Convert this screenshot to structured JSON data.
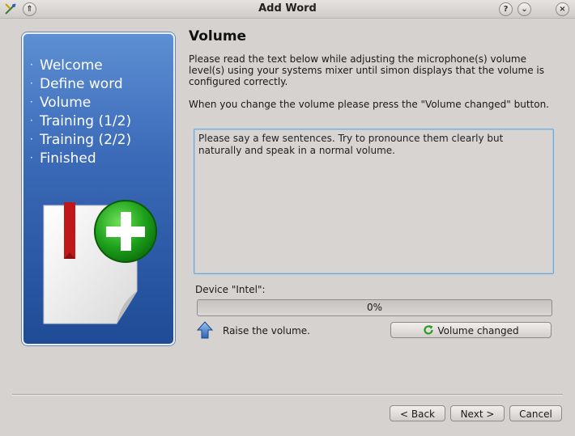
{
  "window": {
    "title": "Add Word",
    "help_label": "?",
    "minimize_label": "⌄",
    "close_label": "×",
    "keep_above_label": "⇑"
  },
  "sidebar": {
    "items": [
      {
        "label": "Welcome"
      },
      {
        "label": "Define word"
      },
      {
        "label": "Volume"
      },
      {
        "label": "Training (1/2)"
      },
      {
        "label": "Training (2/2)"
      },
      {
        "label": "Finished"
      }
    ],
    "bullet": "·"
  },
  "page": {
    "heading": "Volume",
    "intro": "Please read the text below while adjusting the microphone(s) volume level(s) using your systems mixer until simon displays that the volume is configured correctly.",
    "instruction": "When you change the volume please press the \"Volume changed\" button.",
    "sample_text": "Please say a few sentences. Try to pronounce them clearly but naturally and speak in a normal volume.",
    "device_label": "Device \"Intel\":",
    "progress_text": "0%",
    "progress_value": 0,
    "hint": "Raise the volume.",
    "volume_changed_button": "Volume changed"
  },
  "footer": {
    "back_label": "Back",
    "next_label": "Next",
    "cancel_label": "Cancel",
    "back_prefix": "< ",
    "next_suffix": " >"
  },
  "colors": {
    "accent": "#6aa9d8",
    "sidebar_top": "#5d8fd3",
    "sidebar_bottom": "#1f4b96"
  },
  "icons": [
    "app-icon",
    "help-icon",
    "minimize-icon",
    "close-icon",
    "keep-above-icon",
    "arrow-up-icon",
    "refresh-icon",
    "add-document-icon"
  ]
}
